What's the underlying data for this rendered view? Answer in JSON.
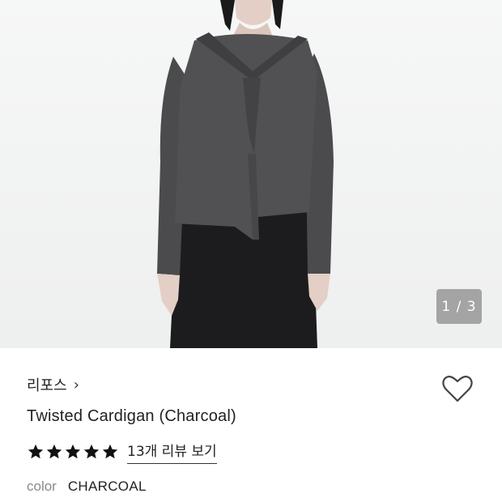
{
  "gallery": {
    "counter": "1 / 3",
    "image_alt_semantic": "product-photo"
  },
  "product": {
    "brand": "리포스",
    "brand_chevron": "›",
    "title": "Twisted Cardigan (Charcoal)",
    "rating": 5,
    "review_link": "13개 리뷰 보기",
    "color_label": "color",
    "color_value": "CHARCOAL"
  },
  "colors": {
    "star": "#111111",
    "garment": "#4a4a4c",
    "pants": "#1c1c1e"
  },
  "icons": {
    "wishlist": "heart-outline-icon",
    "star": "star-filled-icon"
  }
}
